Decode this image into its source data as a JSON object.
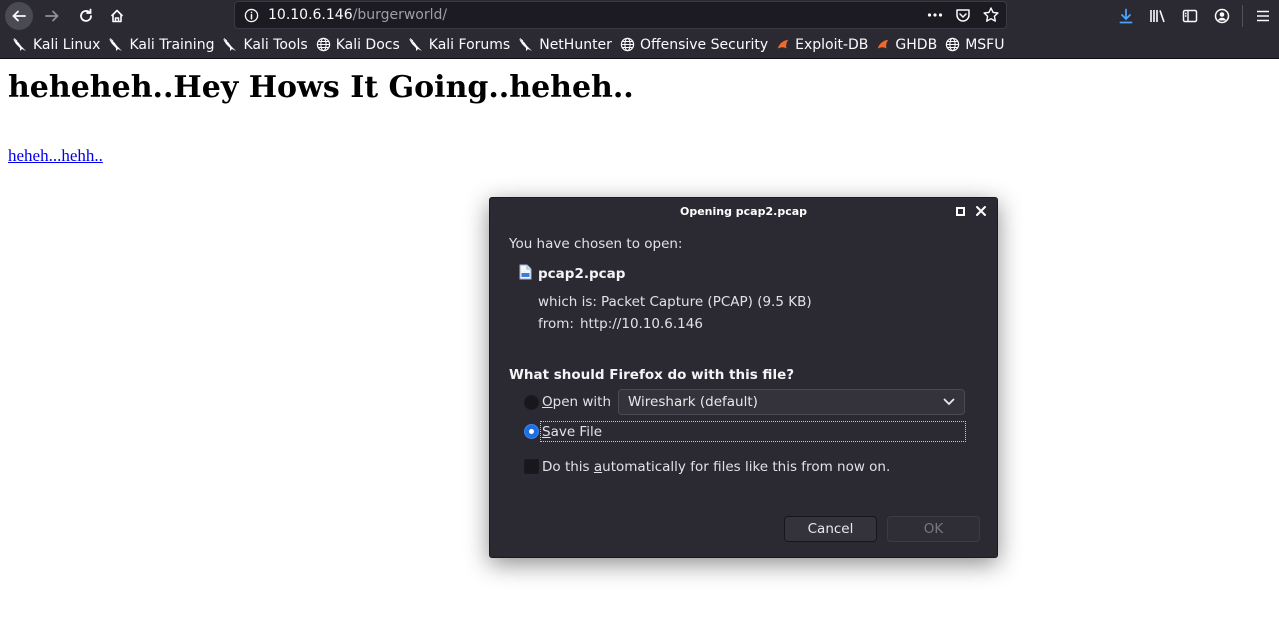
{
  "browser": {
    "url_host": "10.10.6.146",
    "url_path": "/burgerworld/",
    "url_actions_icon": "more-icon",
    "accent": "#2b2a33"
  },
  "bookmarks": [
    {
      "label": "Kali Linux",
      "icon": "kali-dragon-icon"
    },
    {
      "label": "Kali Training",
      "icon": "kali-dragon-icon"
    },
    {
      "label": "Kali Tools",
      "icon": "kali-dragon-icon"
    },
    {
      "label": "Kali Docs",
      "icon": "globe-icon"
    },
    {
      "label": "Kali Forums",
      "icon": "kali-dragon-icon"
    },
    {
      "label": "NetHunter",
      "icon": "kali-dragon-icon"
    },
    {
      "label": "Offensive Security",
      "icon": "globe-icon"
    },
    {
      "label": "Exploit-DB",
      "icon": "exploitdb-icon"
    },
    {
      "label": "GHDB",
      "icon": "exploitdb-icon"
    },
    {
      "label": "MSFU",
      "icon": "globe-icon"
    }
  ],
  "page": {
    "heading": "heheheh..Hey Hows It Going..heheh..",
    "link": "heheh...hehh.."
  },
  "dialog": {
    "title": "Opening pcap2.pcap",
    "chosen_label": "You have chosen to open:",
    "filename": "pcap2.pcap",
    "which_is_label": "which is:",
    "which_is_value": "Packet Capture (PCAP) (9.5 KB)",
    "from_label": "from:",
    "from_value": "http://10.10.6.146",
    "question": "What should Firefox do with this file?",
    "open_with_first": "O",
    "open_with_rest": "pen with",
    "open_with_app": "Wireshark (default)",
    "save_first": "S",
    "save_rest": "ave File",
    "auto_pre": "Do this ",
    "auto_u": "a",
    "auto_post": "utomatically for files like this from now on.",
    "cancel": "Cancel",
    "ok": "OK",
    "selected_option": "Save File"
  }
}
